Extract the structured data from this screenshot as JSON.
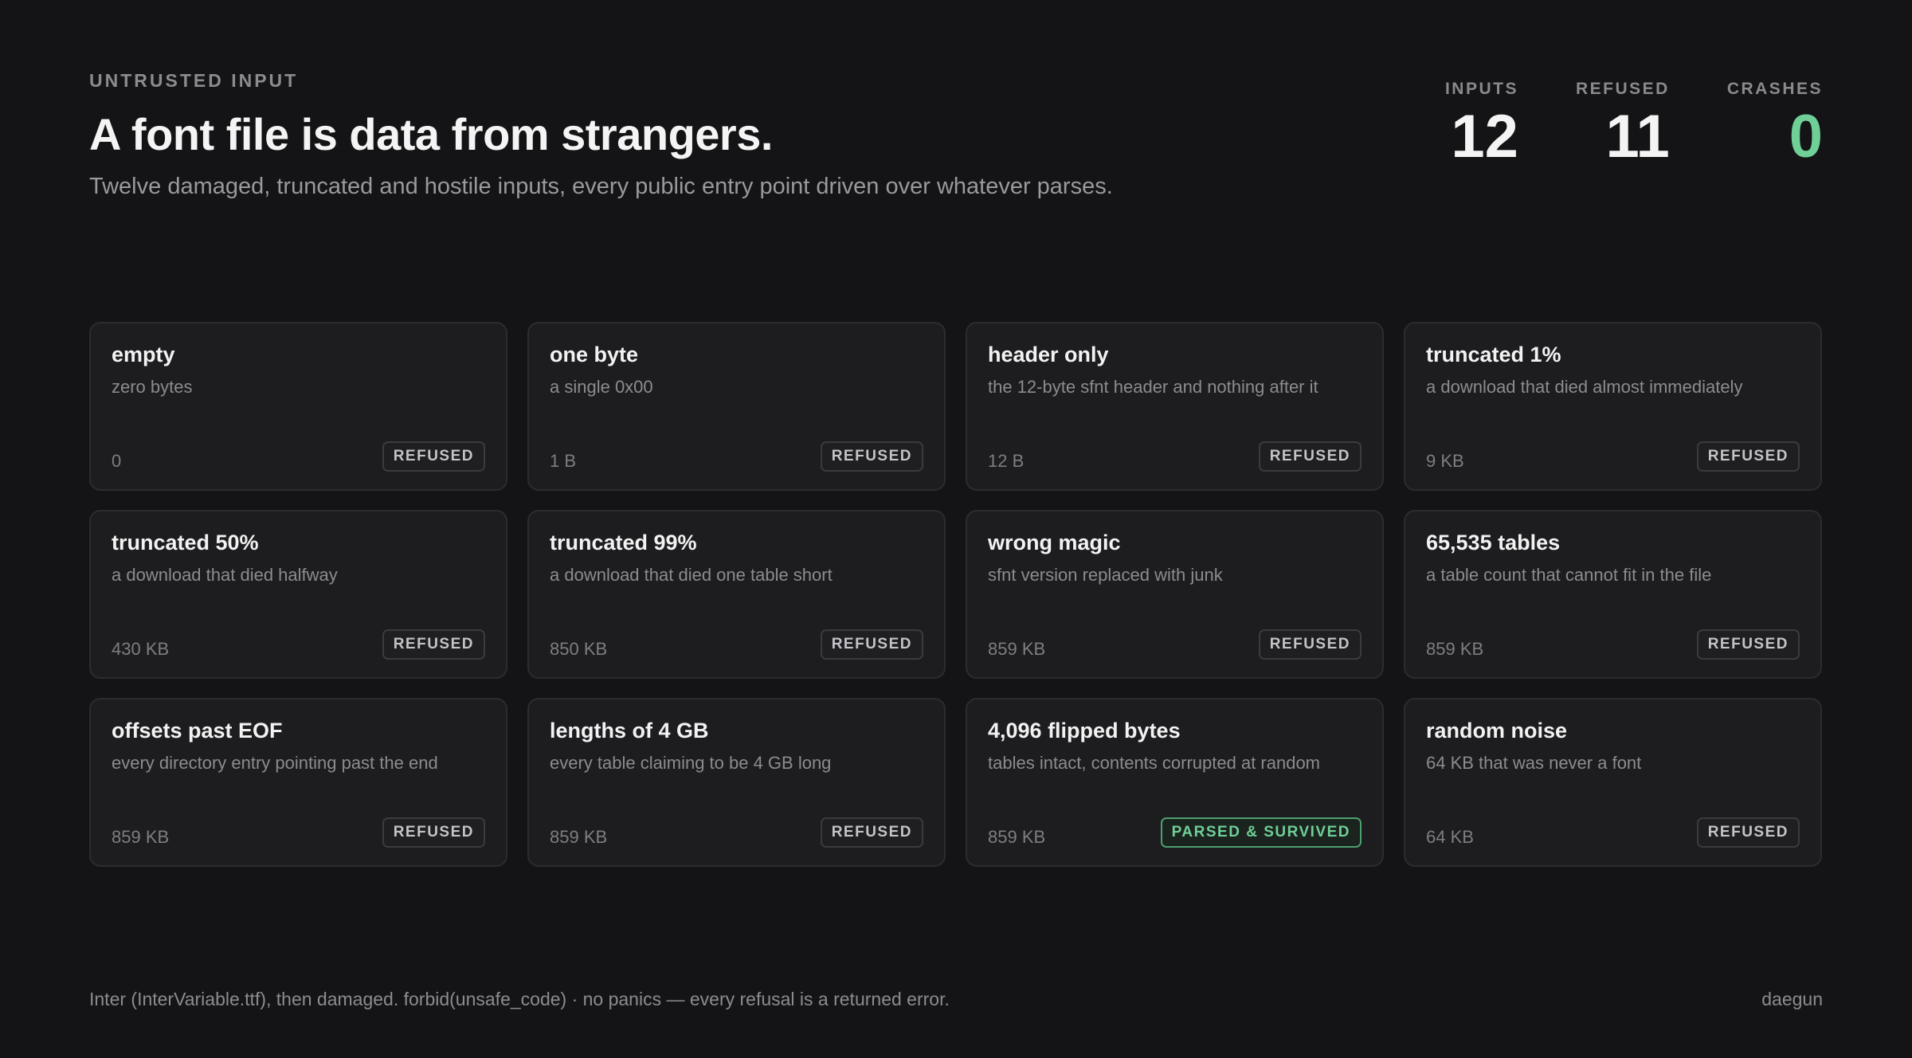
{
  "header": {
    "eyebrow": "UNTRUSTED INPUT",
    "title": "A font file is data from strangers.",
    "subtitle": "Twelve damaged, truncated and hostile inputs, every public entry point driven over whatever parses."
  },
  "stats": [
    {
      "label": "INPUTS",
      "value": "12"
    },
    {
      "label": "REFUSED",
      "value": "11"
    },
    {
      "label": "CRASHES",
      "value": "0",
      "color": "#6fcf97"
    }
  ],
  "cards": [
    {
      "title": "empty",
      "desc": "zero bytes",
      "size": "0",
      "status": "REFUSED"
    },
    {
      "title": "one byte",
      "desc": "a single 0x00",
      "size": "1 B",
      "status": "REFUSED"
    },
    {
      "title": "header only",
      "desc": "the 12-byte sfnt header and nothing after it",
      "size": "12 B",
      "status": "REFUSED"
    },
    {
      "title": "truncated 1%",
      "desc": "a download that died almost immediately",
      "size": "9 KB",
      "status": "REFUSED"
    },
    {
      "title": "truncated 50%",
      "desc": "a download that died halfway",
      "size": "430 KB",
      "status": "REFUSED"
    },
    {
      "title": "truncated 99%",
      "desc": "a download that died one table short",
      "size": "850 KB",
      "status": "REFUSED"
    },
    {
      "title": "wrong magic",
      "desc": "sfnt version replaced with junk",
      "size": "859 KB",
      "status": "REFUSED"
    },
    {
      "title": "65,535 tables",
      "desc": "a table count that cannot fit in the file",
      "size": "859 KB",
      "status": "REFUSED"
    },
    {
      "title": "offsets past EOF",
      "desc": "every directory entry pointing past the end",
      "size": "859 KB",
      "status": "REFUSED"
    },
    {
      "title": "lengths of 4 GB",
      "desc": "every table claiming to be 4 GB long",
      "size": "859 KB",
      "status": "REFUSED"
    },
    {
      "title": "4,096 flipped bytes",
      "desc": "tables intact, contents corrupted at random",
      "size": "859 KB",
      "status": "PARSED & SURVIVED",
      "status_color": "#6fcf97"
    },
    {
      "title": "random noise",
      "desc": "64 KB that was never a font",
      "size": "64 KB",
      "status": "REFUSED"
    }
  ],
  "footer": {
    "note": "Inter (InterVariable.ttf), then damaged. forbid(unsafe_code) · no panics — every refusal is a returned error.",
    "author": "daegun"
  }
}
